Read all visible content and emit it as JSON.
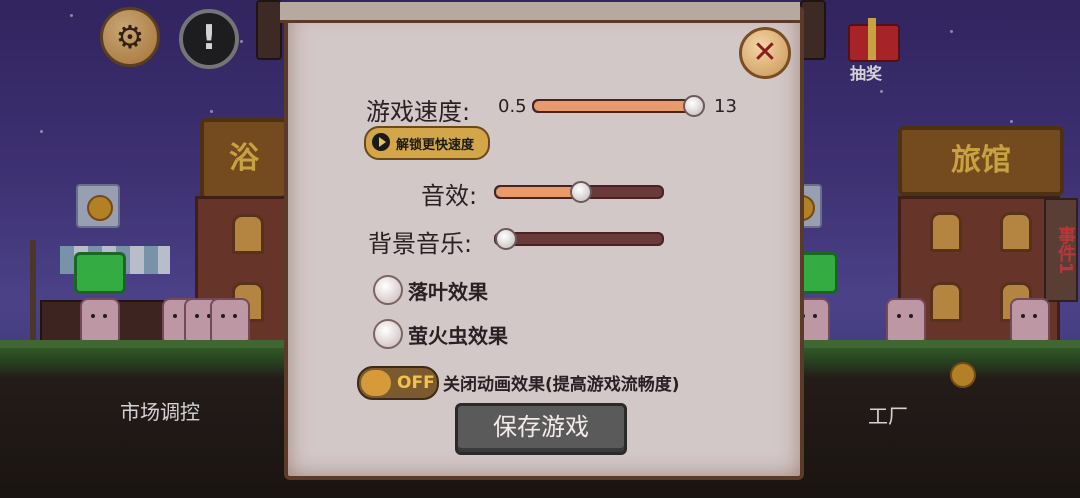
{
  "hud": {
    "settings_icon": "gear-icon",
    "alert_icon": "exclamation-icon",
    "alert_glyph": "!",
    "settings_glyph": "⚙",
    "lottery_label": "抽奖"
  },
  "scene": {
    "left_building_sign": "浴",
    "right_building_sign": "旅馆",
    "left_area_label": "市场调控",
    "right_area_label": "工厂",
    "event_sign": "事件1"
  },
  "dialog": {
    "close_glyph": "✕",
    "game_speed": {
      "label": "游戏速度:",
      "min_label": "0.5",
      "max_label": "13",
      "level": 0.95
    },
    "unlock_button_label": "解锁更快速度",
    "sound_effects": {
      "label": "音效:",
      "level": 0.5
    },
    "background_music": {
      "label": "背景音乐:",
      "level": 0.05
    },
    "falling_leaves": {
      "label": "落叶效果",
      "checked": false
    },
    "fireflies": {
      "label": "萤火虫效果",
      "checked": false
    },
    "animation_toggle": {
      "state_label": "OFF",
      "label": "关闭动画效果(提高游戏流畅度)"
    },
    "save_button_label": "保存游戏"
  },
  "colors": {
    "parchment": "#d3c8c8",
    "slider_fill": "#e89a6a",
    "toggle_off": "#d79a3a"
  }
}
